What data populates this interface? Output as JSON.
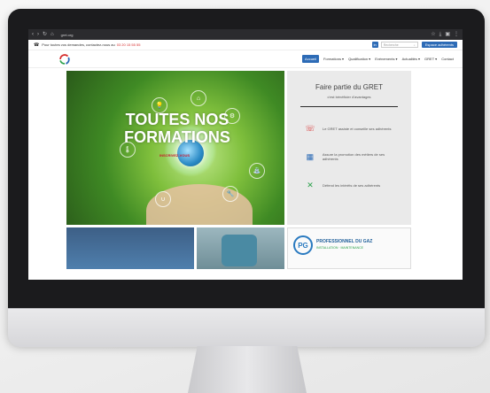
{
  "browser": {
    "url": "gret.org",
    "icons": [
      "back-icon",
      "forward-icon",
      "reload-icon",
      "home-icon"
    ],
    "right_icons": [
      "star-icon",
      "download-icon",
      "tabs-icon",
      "menu-icon"
    ]
  },
  "topbar": {
    "contact_text": "Pour toutes vos demandes, contactez-nous au",
    "phone": "03 20 15 55 55",
    "linkedin": "in",
    "search_placeholder": "Recherche",
    "member_button": "Espace adhérents"
  },
  "nav": {
    "items": [
      "Accueil",
      "Formations ▾",
      "Qualification ▾",
      "Evénements ▾",
      "Actualités ▾",
      "GRET ▾",
      "Contact"
    ]
  },
  "hero": {
    "title": "TOUTES NOS FORMATIONS",
    "subtitle": "INSCRIVEZ-VOUS"
  },
  "panel": {
    "title": "Faire partie du GRET",
    "subtitle": "c'est bénéficier d'avantages",
    "rows": [
      "Le GRET assiste et conseille ses adhérents",
      "Assure la promotion des métiers de ses adhérents",
      "Défend les intérêts de ses adhérents"
    ]
  },
  "promo": {
    "badge": "PG",
    "title": "PROFESSIONNEL DU GAZ",
    "subtitle": "INSTALLATION · MAINTENANCE"
  },
  "colors": {
    "brand_blue": "#2d6bb6",
    "phone_red": "#d62d2d"
  }
}
